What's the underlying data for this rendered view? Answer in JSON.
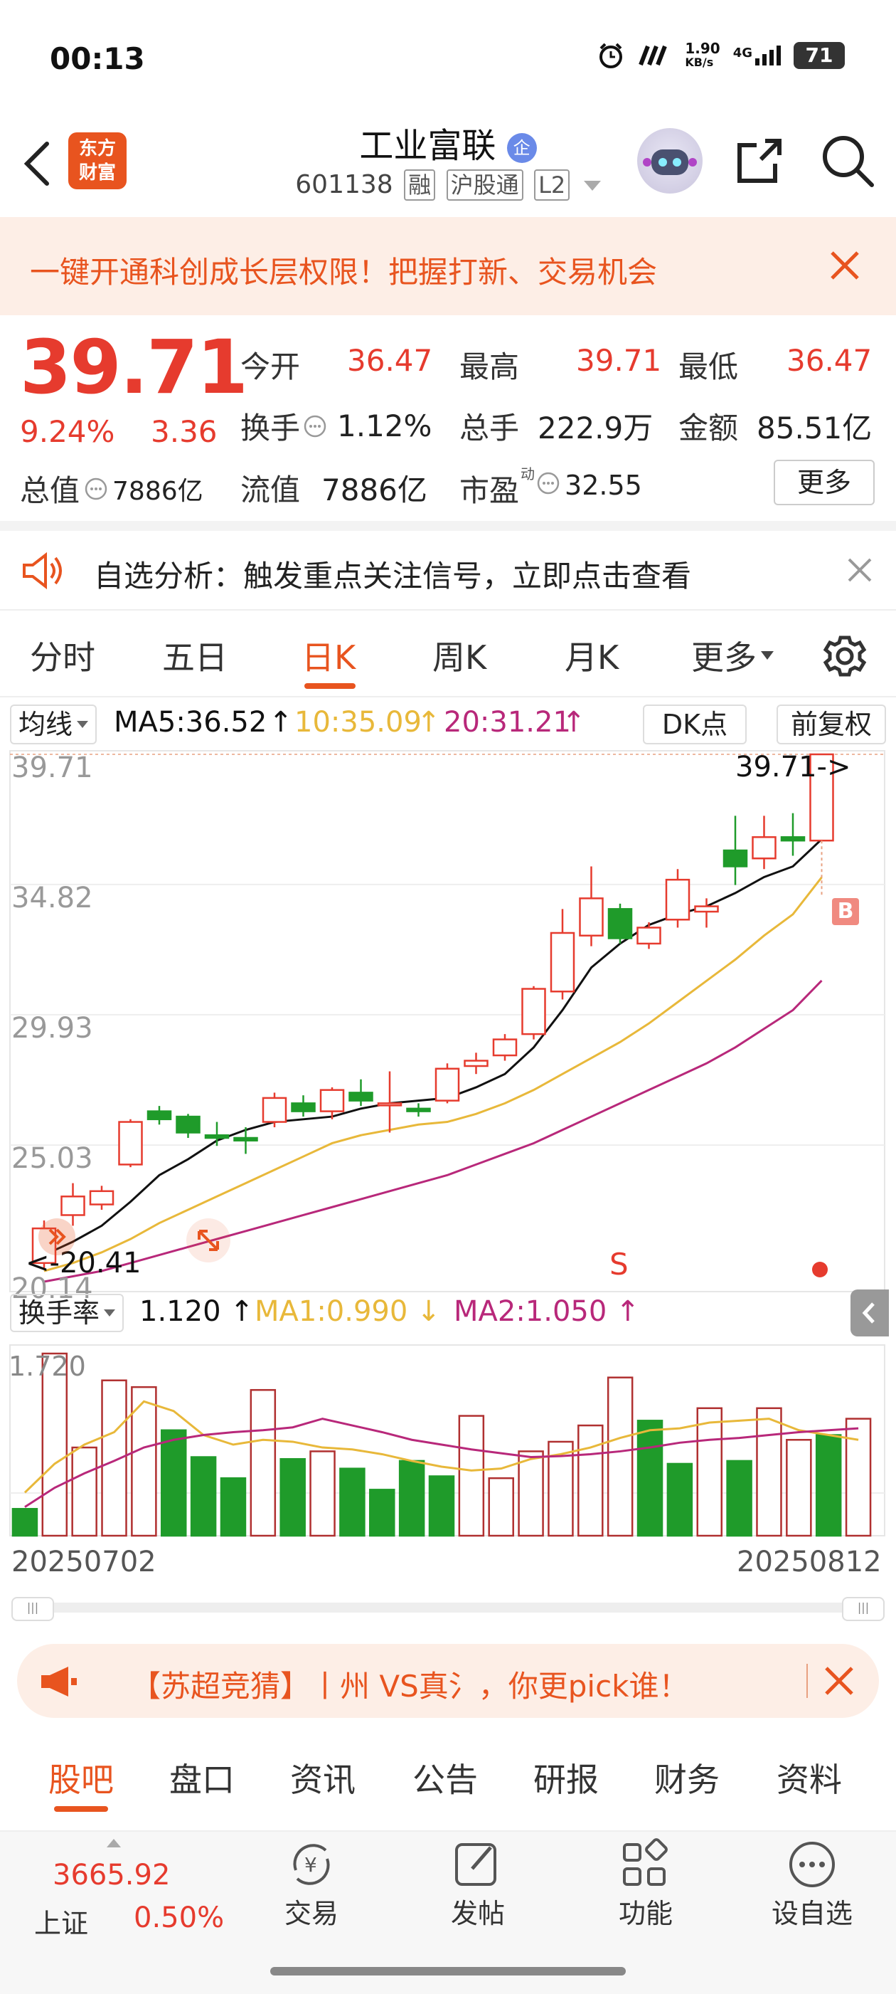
{
  "status_bar": {
    "time": "00:13",
    "net_speed": "1.90",
    "net_unit": "KB/s",
    "network": "4G",
    "battery": "71"
  },
  "header": {
    "app_logo": "东方\n财富",
    "stock_name": "工业富联",
    "stock_badge": "企",
    "stock_code": "601138",
    "tags": [
      "融",
      "沪股通",
      "L2"
    ]
  },
  "promo_banner": {
    "text": "一键开通科创成长层权限！把握打新、交易机会"
  },
  "quote": {
    "price": "39.71",
    "change_pct": "9.24%",
    "change": "3.36",
    "open_label": "今开",
    "open_value": "36.47",
    "high_label": "最高",
    "high_value": "39.71",
    "low_label": "最低",
    "low_value": "36.47",
    "turnover_label": "换手",
    "turnover_value": "1.12%",
    "volume_label": "总手",
    "volume_value": "222.9万",
    "amount_label": "金额",
    "amount_value": "85.51亿",
    "mktcap_label": "总值",
    "mktcap_value": "7886亿",
    "float_label": "流值",
    "float_value": "7886亿",
    "pe_label": "市盈",
    "pe_sup": "动",
    "pe_value": "32.55",
    "more_button": "更多"
  },
  "analysis_banner": {
    "text": "自选分析：触发重点关注信号，立即点击查看"
  },
  "chart_tabs": {
    "items": [
      "分时",
      "五日",
      "日K",
      "周K",
      "月K",
      "更多"
    ],
    "active": "日K"
  },
  "indicator_bar": {
    "ma_label": "均线",
    "ma5": "MA5:36.52",
    "ma10": "10:35.09",
    "ma20": "20:31.21",
    "dk_button": "DK点",
    "adjust_button": "前复权"
  },
  "chart_data": [
    {
      "type": "candlestick",
      "y_ticks": [
        "39.71",
        "34.82",
        "29.93",
        "25.03",
        "20.14"
      ],
      "ylim": [
        20.14,
        39.71
      ],
      "last_price_label": "39.71->",
      "low_marker_label": "<-20.41",
      "signals": [
        {
          "label": "S"
        },
        {
          "label": "B"
        }
      ],
      "candles": [
        {
          "o": 20.6,
          "c": 21.9,
          "h": 22.2,
          "l": 20.41
        },
        {
          "o": 22.4,
          "c": 23.1,
          "h": 23.6,
          "l": 22.0
        },
        {
          "o": 22.8,
          "c": 23.3,
          "h": 23.5,
          "l": 22.6
        },
        {
          "o": 24.3,
          "c": 25.9,
          "h": 26.0,
          "l": 24.2
        },
        {
          "o": 26.3,
          "c": 26.0,
          "h": 26.5,
          "l": 25.8
        },
        {
          "o": 26.1,
          "c": 25.5,
          "h": 26.2,
          "l": 25.3
        },
        {
          "o": 25.4,
          "c": 25.3,
          "h": 25.9,
          "l": 25.0
        },
        {
          "o": 25.3,
          "c": 25.2,
          "h": 25.7,
          "l": 24.7
        },
        {
          "o": 25.9,
          "c": 26.8,
          "h": 27.0,
          "l": 25.7
        },
        {
          "o": 26.6,
          "c": 26.3,
          "h": 26.9,
          "l": 26.1
        },
        {
          "o": 26.3,
          "c": 27.1,
          "h": 27.2,
          "l": 26.0
        },
        {
          "o": 27.0,
          "c": 26.7,
          "h": 27.5,
          "l": 26.5
        },
        {
          "o": 26.6,
          "c": 26.6,
          "h": 27.8,
          "l": 25.5
        },
        {
          "o": 26.4,
          "c": 26.3,
          "h": 26.6,
          "l": 26.1
        },
        {
          "o": 26.7,
          "c": 27.9,
          "h": 28.1,
          "l": 26.6
        },
        {
          "o": 28.0,
          "c": 28.2,
          "h": 28.5,
          "l": 27.7
        },
        {
          "o": 28.4,
          "c": 29.0,
          "h": 29.2,
          "l": 28.2
        },
        {
          "o": 29.2,
          "c": 30.9,
          "h": 31.0,
          "l": 29.0
        },
        {
          "o": 30.8,
          "c": 33.0,
          "h": 33.9,
          "l": 30.5
        },
        {
          "o": 32.9,
          "c": 34.3,
          "h": 35.5,
          "l": 32.5
        },
        {
          "o": 33.9,
          "c": 32.8,
          "h": 34.1,
          "l": 32.6
        },
        {
          "o": 32.6,
          "c": 33.2,
          "h": 33.4,
          "l": 32.4
        },
        {
          "o": 33.5,
          "c": 35.0,
          "h": 35.4,
          "l": 33.2
        },
        {
          "o": 33.8,
          "c": 34.0,
          "h": 34.3,
          "l": 33.2
        },
        {
          "o": 36.1,
          "c": 35.5,
          "h": 37.4,
          "l": 34.8
        },
        {
          "o": 35.8,
          "c": 36.6,
          "h": 37.4,
          "l": 35.4
        },
        {
          "o": 36.6,
          "c": 36.47,
          "h": 37.5,
          "l": 35.9
        },
        {
          "o": 36.47,
          "c": 39.71,
          "h": 39.71,
          "l": 36.47
        }
      ],
      "ma5": [
        20.9,
        21.4,
        22.0,
        22.9,
        23.9,
        24.5,
        25.2,
        25.6,
        25.9,
        26.0,
        26.1,
        26.4,
        26.6,
        26.7,
        26.8,
        27.2,
        27.7,
        28.7,
        30.1,
        31.7,
        32.6,
        33.3,
        33.7,
        34.0,
        34.5,
        35.1,
        35.5,
        36.52
      ],
      "ma10": [
        20.3,
        20.6,
        21.0,
        21.5,
        22.1,
        22.6,
        23.1,
        23.6,
        24.1,
        24.6,
        25.1,
        25.4,
        25.6,
        25.8,
        25.9,
        26.2,
        26.6,
        27.1,
        27.7,
        28.3,
        28.9,
        29.6,
        30.4,
        31.2,
        32.0,
        32.9,
        33.7,
        35.09
      ],
      "ma20": [
        19.9,
        20.1,
        20.3,
        20.6,
        20.9,
        21.2,
        21.5,
        21.8,
        22.1,
        22.4,
        22.7,
        23.0,
        23.3,
        23.6,
        23.9,
        24.3,
        24.7,
        25.1,
        25.6,
        26.1,
        26.6,
        27.1,
        27.6,
        28.1,
        28.7,
        29.4,
        30.1,
        31.21
      ]
    },
    {
      "type": "bar",
      "indicator": "换手率",
      "value": "1.120",
      "ma1_label": "MA1:0.990",
      "ma2_label": "MA2:1.050",
      "y_max_label": "1.720",
      "ylim": [
        0,
        1.9
      ],
      "start_date": "20250702",
      "end_date": "20250812",
      "bars": [
        {
          "v": 0.28,
          "up": false
        },
        {
          "v": 1.9,
          "up": true
        },
        {
          "v": 0.92,
          "up": true
        },
        {
          "v": 1.62,
          "up": true
        },
        {
          "v": 1.55,
          "up": true
        },
        {
          "v": 1.1,
          "up": false
        },
        {
          "v": 0.82,
          "up": false
        },
        {
          "v": 0.6,
          "up": false
        },
        {
          "v": 1.52,
          "up": true
        },
        {
          "v": 0.8,
          "up": false
        },
        {
          "v": 0.88,
          "up": true
        },
        {
          "v": 0.7,
          "up": false
        },
        {
          "v": 0.48,
          "up": false
        },
        {
          "v": 0.78,
          "up": false
        },
        {
          "v": 0.62,
          "up": false
        },
        {
          "v": 1.25,
          "up": true
        },
        {
          "v": 0.6,
          "up": true
        },
        {
          "v": 0.88,
          "up": true
        },
        {
          "v": 0.98,
          "up": true
        },
        {
          "v": 1.15,
          "up": true
        },
        {
          "v": 1.65,
          "up": true
        },
        {
          "v": 1.2,
          "up": false
        },
        {
          "v": 0.75,
          "up": false
        },
        {
          "v": 1.33,
          "up": true
        },
        {
          "v": 0.78,
          "up": false
        },
        {
          "v": 1.33,
          "up": true
        },
        {
          "v": 1.0,
          "up": true
        },
        {
          "v": 1.05,
          "up": false
        },
        {
          "v": 1.22,
          "up": true
        }
      ],
      "ma1": [
        0.45,
        0.75,
        0.95,
        1.08,
        1.4,
        1.3,
        1.05,
        0.95,
        1.0,
        0.98,
        0.92,
        0.9,
        0.85,
        0.78,
        0.72,
        0.68,
        0.7,
        0.8,
        0.85,
        0.92,
        1.02,
        1.1,
        1.12,
        1.18,
        1.2,
        1.22,
        1.1,
        1.05,
        1.0
      ],
      "ma2": [
        0.3,
        0.5,
        0.65,
        0.78,
        0.92,
        1.0,
        1.05,
        1.08,
        1.1,
        1.13,
        1.22,
        1.15,
        1.08,
        1.0,
        0.95,
        0.9,
        0.86,
        0.82,
        0.83,
        0.85,
        0.88,
        0.92,
        0.97,
        1.0,
        1.02,
        1.05,
        1.08,
        1.1,
        1.12
      ]
    }
  ],
  "ad_banner": {
    "text": "【苏超竞猜】丨州 VS真氵，你更pick谁！"
  },
  "sub_tabs": {
    "items": [
      "股吧",
      "盘口",
      "资讯",
      "公告",
      "研报",
      "财务",
      "资料"
    ],
    "active": "股吧"
  },
  "bottom_nav": {
    "index_value": "3665.92",
    "index_name": "上证",
    "index_change": "0.50%",
    "items": [
      {
        "label": "交易",
        "icon": "yen-cycle-icon"
      },
      {
        "label": "发帖",
        "icon": "edit-icon"
      },
      {
        "label": "功能",
        "icon": "grid-icon"
      },
      {
        "label": "设自选",
        "icon": "more-dots-icon"
      }
    ]
  },
  "colors": {
    "up": "#e63b2e",
    "down": "#1f9b2a",
    "accent": "#e8541f",
    "ma5": "#111111",
    "ma10": "#e8b83a",
    "ma20": "#b8287a"
  }
}
